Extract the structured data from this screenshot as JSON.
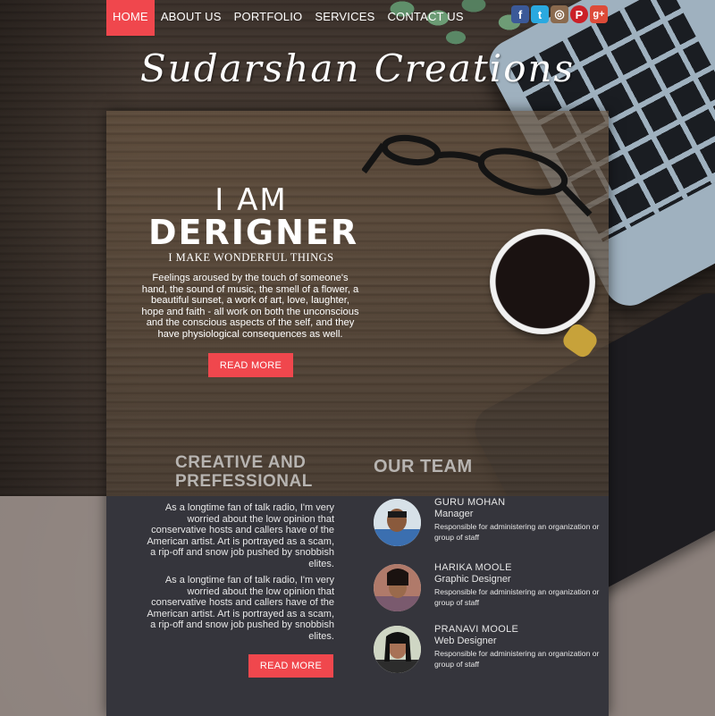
{
  "nav": {
    "items": [
      {
        "label": "HOME",
        "active": true
      },
      {
        "label": "ABOUT US",
        "active": false
      },
      {
        "label": "PORTFOLIO",
        "active": false
      },
      {
        "label": "SERVICES",
        "active": false
      },
      {
        "label": "CONTACT US",
        "active": false
      }
    ]
  },
  "social": [
    {
      "icon": "facebook-icon",
      "glyph": "f",
      "color": "#3b5998"
    },
    {
      "icon": "twitter-icon",
      "glyph": "t",
      "color": "#2aa9e0"
    },
    {
      "icon": "instagram-icon",
      "glyph": "◎",
      "color": "#8a6a4e"
    },
    {
      "icon": "pinterest-icon",
      "glyph": "P",
      "color": "#cb2027"
    },
    {
      "icon": "google-plus-icon",
      "glyph": "g+",
      "color": "#dd4b39"
    }
  ],
  "brand": "Sudarshan Creations",
  "hero": {
    "line1": "I AM",
    "line2": "DERIGNER",
    "subtitle": "I MAKE WONDERFUL THINGS",
    "text": "Feelings aroused by the touch of someone's hand, the sound of music, the smell of a flower, a beautiful sunset, a work of art, love, laughter, hope and faith - all work on both the unconscious and the conscious aspects of the self, and they have physiological consequences as well.",
    "button": "READ MORE"
  },
  "creative": {
    "heading": "CREATIVE AND PREFESSIONAL",
    "para1": "As a longtime fan of talk radio, I'm very worried about the low opinion that conservative hosts and callers have of the American artist. Art is portrayed as a scam, a rip-off and snow job pushed by snobbish elites.",
    "para2": "As a longtime fan of talk radio, I'm very worried about the low opinion that conservative hosts and callers have of the American artist. Art is portrayed as a scam, a rip-off and snow job pushed by snobbish elites.",
    "button": "READ MORE"
  },
  "team": {
    "heading": "OUR TEAM",
    "members": [
      {
        "name": "GURU MOHAN",
        "role": "Manager",
        "desc": "Responsible for administering an organization or group of staff"
      },
      {
        "name": "HARIKA MOOLE",
        "role": "Graphic Designer",
        "desc": "Responsible for administering an organization or group of staff"
      },
      {
        "name": "PRANAVI MOOLE",
        "role": "Web Designer",
        "desc": "Responsible for administering an organization or group of staff"
      }
    ]
  },
  "colors": {
    "accent": "#f0474d",
    "panel": "#35353c"
  }
}
